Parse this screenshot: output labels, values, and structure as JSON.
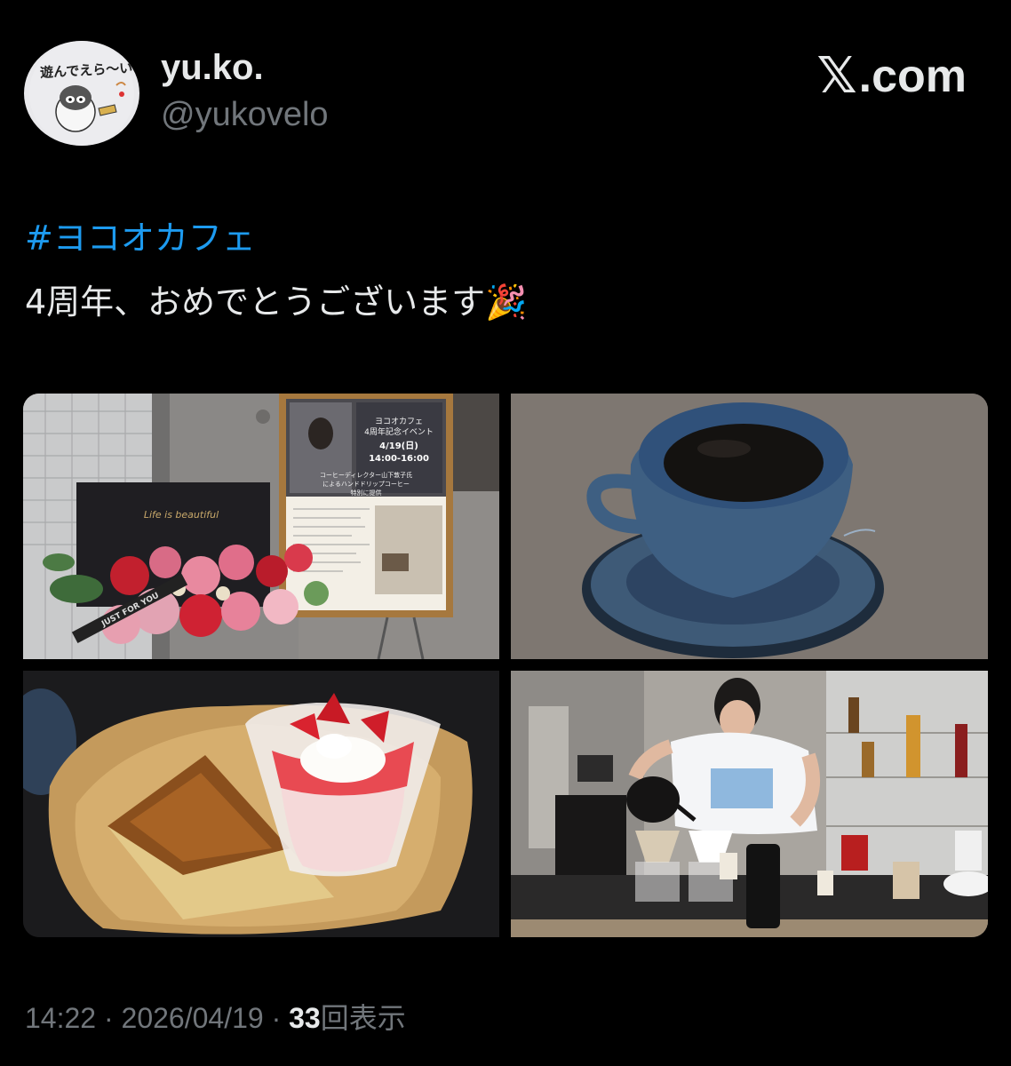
{
  "author": {
    "display_name": "yu.ko.",
    "handle": "@yukovelo",
    "avatar_caption": "遊んでえら〜い!"
  },
  "brand": {
    "x_symbol": "𝕏",
    "domain": ".com"
  },
  "tweet": {
    "hashtag": "#ヨコオカフェ",
    "text": "4周年、おめでとうございます",
    "emoji": "🎉"
  },
  "media": {
    "poster": {
      "line1": "ヨコオカフェ",
      "line2": "4周年記念イベント",
      "date": "4/19(日)",
      "time": "14:00-16:00",
      "line3": "コーヒーディレクター山下敦子氏",
      "line4": "によるハンドドリップコーヒー",
      "line5": "特別に提供"
    },
    "card_text": "Life is beautiful",
    "ribbon_text": "JUST FOR YOU"
  },
  "meta": {
    "time": "14:22",
    "separator": "·",
    "date": "2026/04/19",
    "views_count": "33",
    "views_label": "回表示"
  }
}
